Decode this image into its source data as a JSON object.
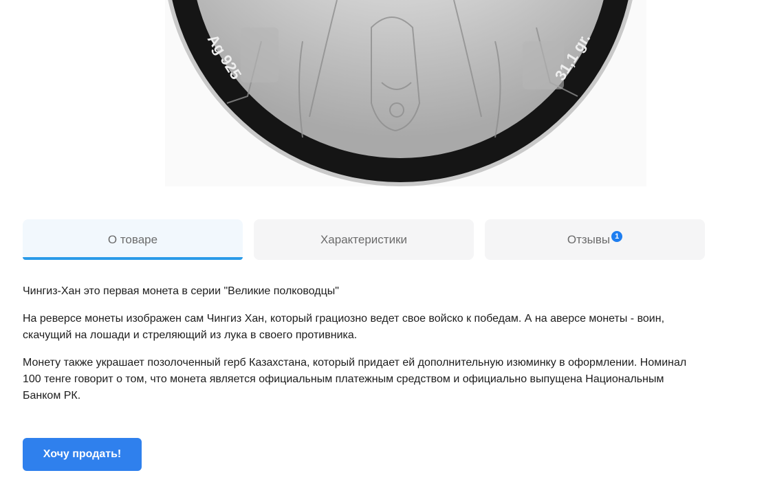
{
  "coin": {
    "alt_description_icon": "coin-image",
    "left_inscription": "Ag 925",
    "right_inscription": "31,1 gr."
  },
  "tabs": [
    {
      "label": "О товаре",
      "active": true
    },
    {
      "label": "Характеристики",
      "active": false
    },
    {
      "label": "Отзывы",
      "active": false,
      "badge": "1"
    }
  ],
  "description": {
    "p1": "Чингиз-Хан это первая монета в серии \"Великие полководцы\"",
    "p2": "На реверсе монеты изображен сам Чингиз Хан, который грациозно ведет свое войско к победам. А на аверсе монеты - воин, скачущий на лошади и стреляющий из лука в своего противника.",
    "p3": "Монету также украшает позолоченный герб Казахстана, который придает ей дополнительную изюминку в оформлении. Номинал 100 тенге говорит о том, что монета является официальным платежным средством и официально выпущена Национальным Банком РК."
  },
  "actions": {
    "sell_label": "Хочу продать!"
  },
  "colors": {
    "accent": "#2f80ed",
    "tab_indicator": "#2b9be8",
    "badge": "#1e7ef0"
  }
}
